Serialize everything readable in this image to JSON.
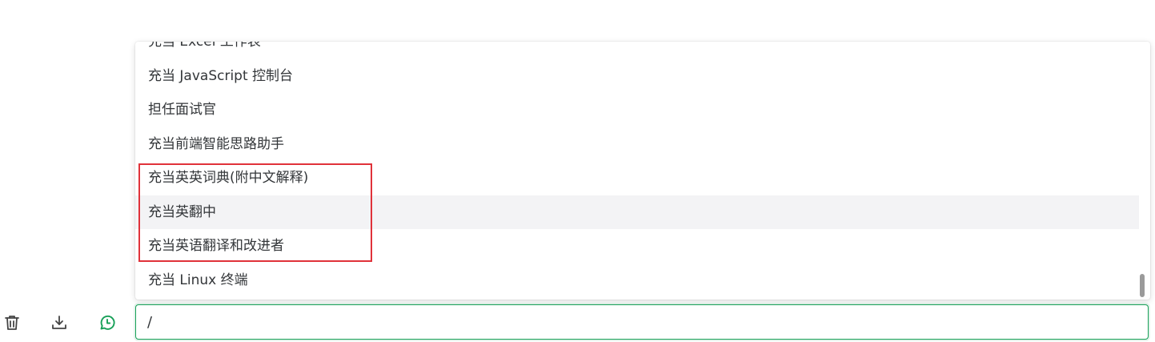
{
  "dropdown": {
    "items": [
      {
        "label": "充当 Excel 工作表"
      },
      {
        "label": "充当 JavaScript 控制台"
      },
      {
        "label": "担任面试官"
      },
      {
        "label": "充当前端智能思路助手"
      },
      {
        "label": "充当英英词典(附中文解释)"
      },
      {
        "label": "充当英翻中"
      },
      {
        "label": "充当英语翻译和改进者"
      },
      {
        "label": "充当 Linux 终端"
      }
    ],
    "hovered_index": 5
  },
  "toolbar": {
    "icons": [
      "trash-icon",
      "download-icon",
      "history-icon"
    ],
    "history_icon_color": "#18a058"
  },
  "prompt_input": {
    "value": "/"
  },
  "colors": {
    "accent": "#18a058",
    "highlight_border": "#e0323a",
    "hover_bg": "#f3f3f5",
    "text": "#333639"
  }
}
